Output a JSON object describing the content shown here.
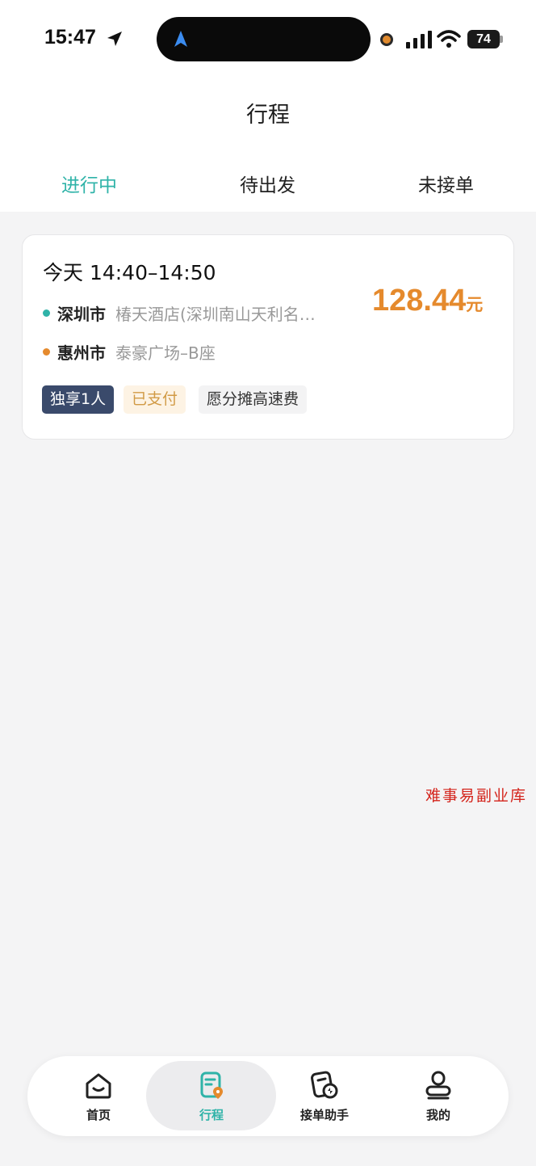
{
  "status_bar": {
    "time": "15:47",
    "battery": "74"
  },
  "header": {
    "title": "行程"
  },
  "tabs": [
    {
      "label": "进行中",
      "active": true
    },
    {
      "label": "待出发",
      "active": false
    },
    {
      "label": "未接单",
      "active": false
    }
  ],
  "trip": {
    "time_range": "今天 14:40–14:50",
    "origin_city": "深圳市",
    "origin_address": "椿天酒店(深圳南山天利名…",
    "dest_city": "惠州市",
    "dest_address": "泰豪广场–B座",
    "price": "128.44",
    "price_unit": "元",
    "tags": [
      "独享1人",
      "已支付",
      "愿分摊高速费"
    ]
  },
  "watermark": "难事易副业库",
  "bottom_nav": [
    {
      "label": "首页",
      "icon": "home-icon",
      "active": false
    },
    {
      "label": "行程",
      "icon": "trip-icon",
      "active": true
    },
    {
      "label": "接单助手",
      "icon": "order-assistant-icon",
      "active": false
    },
    {
      "label": "我的",
      "icon": "profile-icon",
      "active": false
    }
  ],
  "colors": {
    "accent": "#2fb3a8",
    "price": "#e58a2d",
    "origin_dot": "#2fb3a8",
    "dest_dot": "#e58a2d",
    "tag_dark": "#3a4a6b"
  }
}
